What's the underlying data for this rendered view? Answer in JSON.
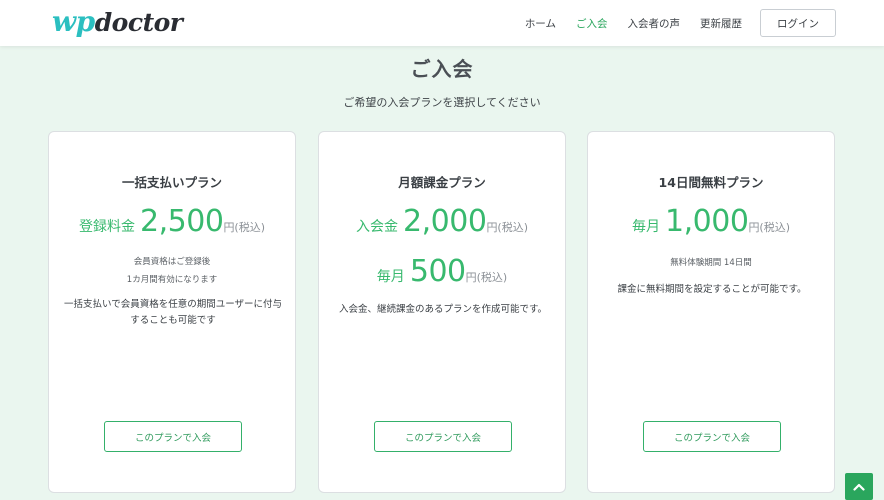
{
  "header": {
    "logo": {
      "wp": "wp",
      "doctor": "doctor"
    },
    "nav": [
      "ホーム",
      "ご入会",
      "入会者の声",
      "更新履歴"
    ],
    "active_nav": "ご入会",
    "login_label": "ログイン"
  },
  "page": {
    "title": "ご入会",
    "subtitle": "ご希望の入会プランを選択してください"
  },
  "plans": [
    {
      "title": "一括支払いプラン",
      "price_label": "登録料金",
      "price_amount": "2,500",
      "price_unit": "円(税込)",
      "notes": [
        "会員資格はご登録後",
        "1カ月間有効になります"
      ],
      "description": "一括支払いで会員資格を任意の期間ユーザーに付与することも可能です",
      "button_label": "このプランで入会"
    },
    {
      "title": "月額課金プラン",
      "price_label": "入会金",
      "price_amount": "2,000",
      "price_unit": "円(税込)",
      "price2_label": "毎月",
      "price2_amount": "500",
      "price2_unit": "円(税込)",
      "description": "入会金、継続課金のあるプランを作成可能です。",
      "button_label": "このプランで入会"
    },
    {
      "title": "14日間無料プラン",
      "price_label": "毎月",
      "price_amount": "1,000",
      "price_unit": "円(税込)",
      "notes": [
        "無料体験期間 14日間"
      ],
      "description": "課金に無料期間を設定することが可能です。",
      "button_label": "このプランで入会"
    }
  ],
  "colors": {
    "accent": "#2aa65d",
    "price": "#38b96e",
    "logo_wp": "#2bbfc0",
    "background": "#eaf6ef"
  },
  "icons": {
    "scroll_top": "chevron-up-icon"
  }
}
